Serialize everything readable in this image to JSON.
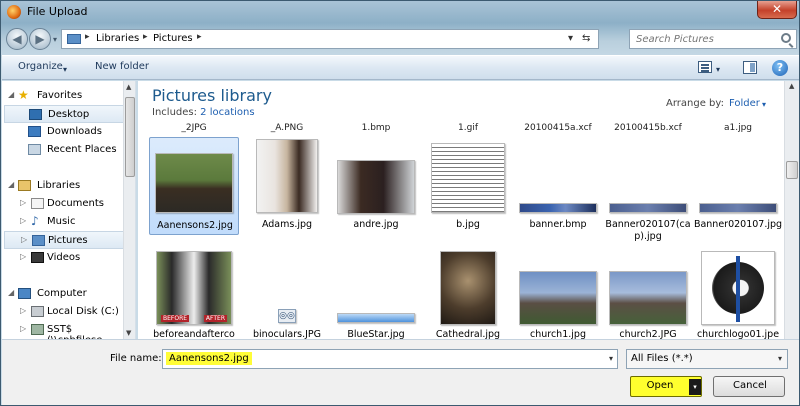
{
  "window": {
    "title": "File Upload",
    "close_glyph": "✕"
  },
  "address_bar": {
    "crumbs": [
      "Libraries",
      "Pictures"
    ],
    "separator": "▸",
    "back_glyph": "◀",
    "forward_glyph": "▶",
    "dropdown_glyph": "▾",
    "refresh_glyph": "⇆"
  },
  "search": {
    "placeholder": "Search Pictures"
  },
  "toolbar": {
    "organize": "Organize",
    "new_folder": "New folder",
    "dropdown_glyph": "▾",
    "help_glyph": "?"
  },
  "nav": {
    "favorites_header": "Favorites",
    "favorites": [
      "Desktop",
      "Downloads",
      "Recent Places"
    ],
    "libraries_header": "Libraries",
    "libraries": [
      "Documents",
      "Music",
      "Pictures",
      "Videos"
    ],
    "computer_header": "Computer",
    "computer": [
      "Local Disk (C:)",
      "SST$ (\\\\cphfilese"
    ],
    "expand_glyph": "▷",
    "collapse_glyph": "◢",
    "selected": "Pictures"
  },
  "library": {
    "title": "Pictures library",
    "includes_label": "Includes:",
    "locations": "2 locations",
    "arrange_label": "Arrange by:",
    "arrange_value": "Folder"
  },
  "cut_off_files": [
    "_2JPG",
    "_A.PNG",
    "1.bmp",
    "1.gif",
    "20100415a.xcf",
    "20100415b.xcf",
    "a1.jpg"
  ],
  "files_row1": [
    {
      "line1": "Aanensons2.jpg",
      "line2": "",
      "selected": true
    },
    {
      "line1": "Adams.jpg",
      "line2": ""
    },
    {
      "line1": "andre.jpg",
      "line2": ""
    },
    {
      "line1": "b.jpg",
      "line2": ""
    },
    {
      "line1": "banner.bmp",
      "line2": ""
    },
    {
      "line1": "Banner020107(ca",
      "line2": "p).jpg"
    },
    {
      "line1": "Banner020107.jpg",
      "line2": ""
    }
  ],
  "files_row2": [
    {
      "line1": "beforeandafterco",
      "line2": ""
    },
    {
      "line1": "binoculars.JPG",
      "line2": ""
    },
    {
      "line1": "BlueStar.jpg",
      "line2": ""
    },
    {
      "line1": "Cathedral.jpg",
      "line2": ""
    },
    {
      "line1": "church1.jpg",
      "line2": ""
    },
    {
      "line1": "church2.JPG",
      "line2": ""
    },
    {
      "line1": "churchlogo01.jpe",
      "line2": ""
    }
  ],
  "thumb_text": {
    "before": "BEFORE",
    "after": "AFTER"
  },
  "bottom": {
    "file_name_label": "File name:",
    "file_name_value": "Aanensons2.jpg",
    "filter_value": "All Files (*.*)",
    "open_label": "Open",
    "cancel_label": "Cancel",
    "dropdown_glyph": "▾"
  },
  "colors": {
    "highlight_yellow": "#ffff2e",
    "title_blue": "#1e5b8e",
    "link_blue": "#1e5fb0"
  }
}
